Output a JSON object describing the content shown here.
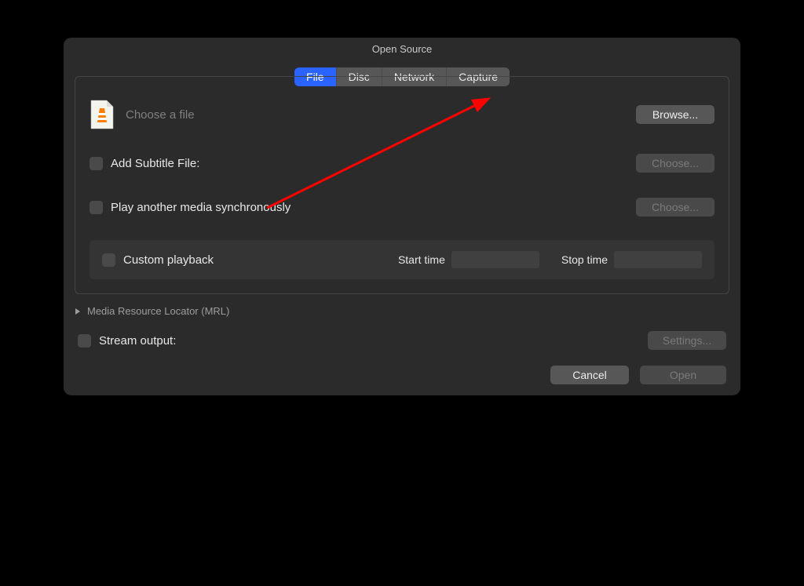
{
  "window": {
    "title": "Open Source"
  },
  "tabs": [
    {
      "label": "File",
      "active": true
    },
    {
      "label": "Disc",
      "active": false
    },
    {
      "label": "Network",
      "active": false
    },
    {
      "label": "Capture",
      "active": false
    }
  ],
  "filePanel": {
    "chooseFilePlaceholder": "Choose a file",
    "browseButton": "Browse...",
    "addSubtitleLabel": "Add Subtitle File:",
    "addSubtitleChoose": "Choose...",
    "playAnotherLabel": "Play another media synchronously",
    "playAnotherChoose": "Choose...",
    "customPlayback": {
      "label": "Custom playback",
      "startTimeLabel": "Start time",
      "startTimeValue": "",
      "stopTimeLabel": "Stop time",
      "stopTimeValue": ""
    }
  },
  "mrl": {
    "label": "Media Resource Locator (MRL)"
  },
  "streamOutput": {
    "label": "Stream output:",
    "settingsButton": "Settings..."
  },
  "footer": {
    "cancel": "Cancel",
    "open": "Open"
  },
  "icons": {
    "vlcFile": "vlc-file-icon",
    "disclosure": "disclosure-triangle-icon"
  }
}
